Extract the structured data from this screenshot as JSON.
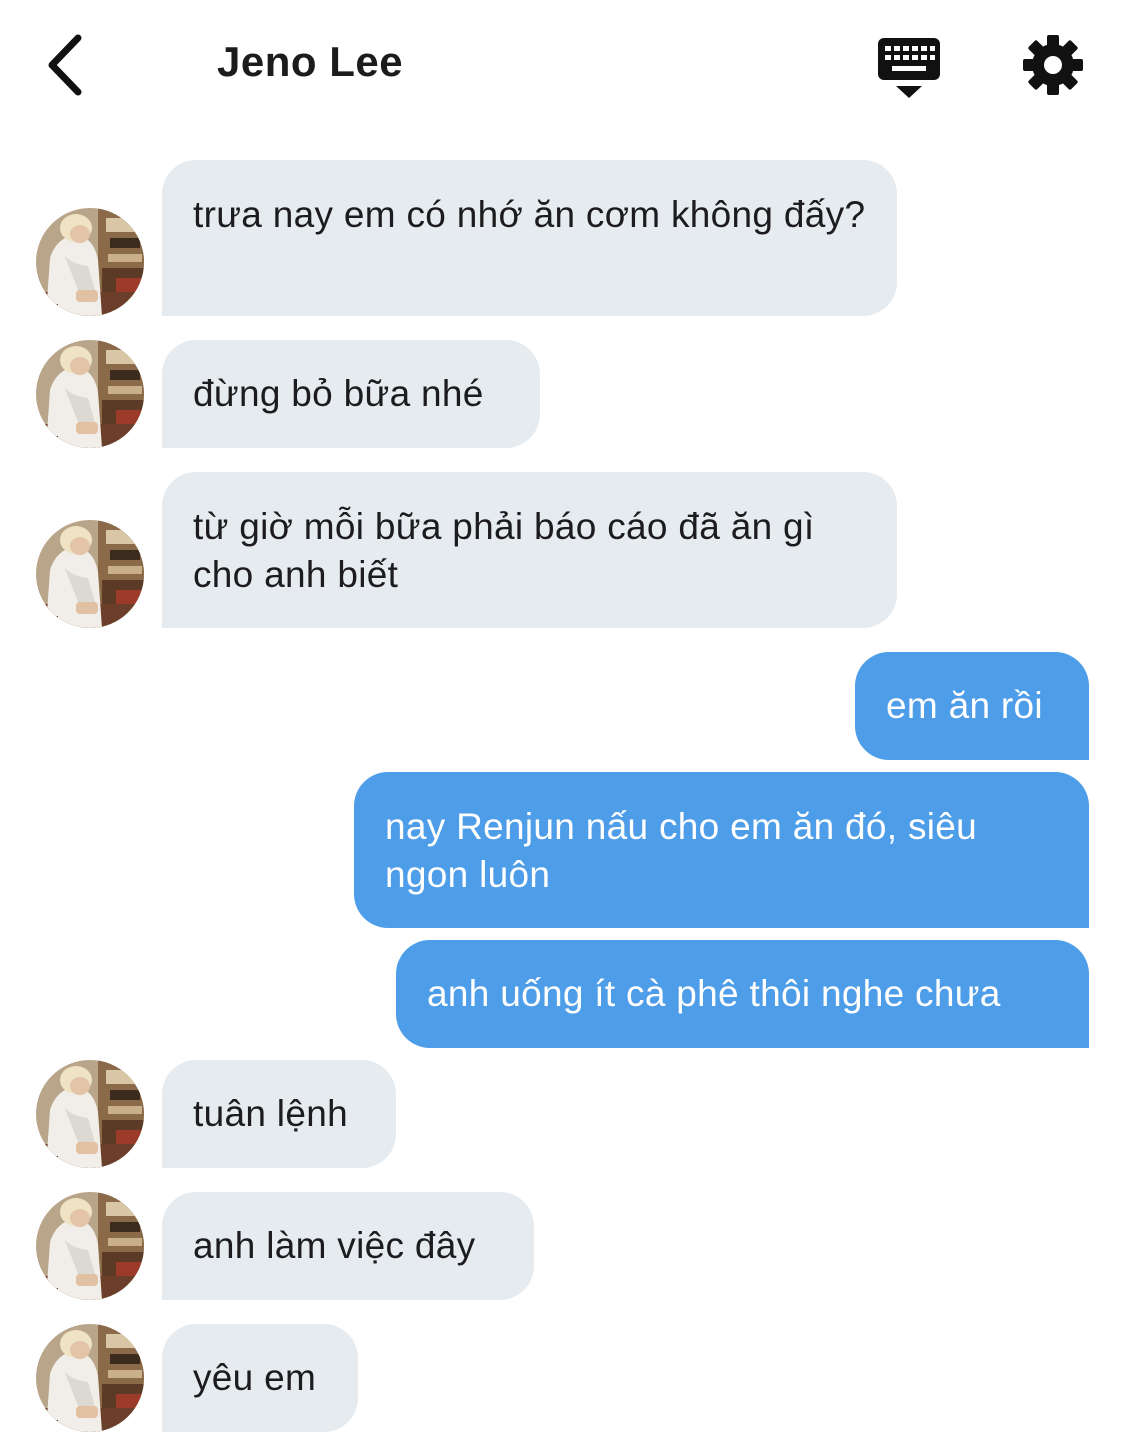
{
  "header": {
    "back_icon": "chevron-left-icon",
    "title": "Jeno Lee",
    "keyboard_icon": "keyboard-icon",
    "settings_icon": "gear-icon"
  },
  "messages": [
    {
      "sender": "Jeno Lee",
      "direction": "incoming",
      "text": "trưa nay em có nhớ ăn cơm không đấy?"
    },
    {
      "sender": "Jeno Lee",
      "direction": "incoming",
      "text": "đừng bỏ bữa nhé"
    },
    {
      "sender": "Jeno Lee",
      "direction": "incoming",
      "text": "từ giờ mỗi bữa phải báo cáo đã ăn gì cho anh biết"
    },
    {
      "sender": "me",
      "direction": "outgoing",
      "text": "em ăn rồi"
    },
    {
      "sender": "me",
      "direction": "outgoing",
      "text": "nay Renjun nấu cho em ăn đó, siêu ngon luôn"
    },
    {
      "sender": "me",
      "direction": "outgoing",
      "text": "anh uống ít cà phê thôi nghe chưa"
    },
    {
      "sender": "Jeno Lee",
      "direction": "incoming",
      "text": "tuân lệnh"
    },
    {
      "sender": "Jeno Lee",
      "direction": "incoming",
      "text": "anh làm việc đây"
    },
    {
      "sender": "Jeno Lee",
      "direction": "incoming",
      "text": "yêu em"
    }
  ],
  "colors": {
    "incoming_bubble": "#e6ebf0",
    "outgoing_bubble": "#4d9de8",
    "title_text": "#1c1c1e"
  }
}
